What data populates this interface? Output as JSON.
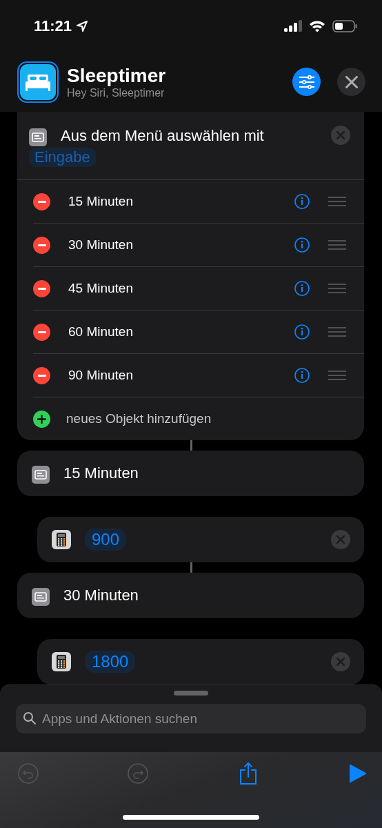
{
  "status_bar": {
    "time": "11:21"
  },
  "header": {
    "title": "Sleeptimer",
    "subtitle": "Hey Siri, Sleeptimer"
  },
  "menu_action": {
    "title": "Aus dem Menü auswählen mit",
    "variable": "Eingabe",
    "items": [
      {
        "kind": "remove",
        "label": "15 Minuten"
      },
      {
        "kind": "remove",
        "label": "30 Minuten"
      },
      {
        "kind": "remove",
        "label": "45 Minuten"
      },
      {
        "kind": "remove",
        "label": "60 Minuten"
      },
      {
        "kind": "remove",
        "label": "90 Minuten"
      },
      {
        "kind": "add",
        "label": "neues Objekt hinzufügen"
      }
    ]
  },
  "blocks": [
    {
      "kind": "case",
      "label": "15 Minuten"
    },
    {
      "kind": "number",
      "value": "900"
    },
    {
      "kind": "case",
      "label": "30 Minuten"
    },
    {
      "kind": "number",
      "value": "1800"
    }
  ],
  "search": {
    "placeholder": "Apps und Aktionen suchen"
  },
  "toolbar": [
    {
      "kind": "undo",
      "disabled": true
    },
    {
      "kind": "redo",
      "disabled": true
    },
    {
      "kind": "share",
      "disabled": false
    },
    {
      "kind": "run",
      "disabled": false
    }
  ]
}
